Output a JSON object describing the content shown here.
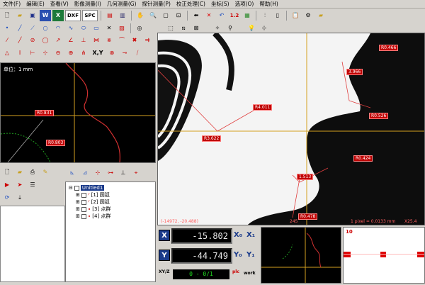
{
  "menu": [
    "文件(F)",
    "编辑(E)",
    "查看(V)",
    "影像测量(I)",
    "几何测量(G)",
    "探针测量(P)",
    "校正处理(C)",
    "坐标(S)",
    "选项(O)",
    "帮助(H)"
  ],
  "toolbar1": {
    "dxf_label": "DXF",
    "spc_label": "SPC",
    "count_label": "1.2"
  },
  "toolbar3": {
    "xy_label": "X,Y"
  },
  "left_view": {
    "unit_label": "单位：1 mm",
    "measure_a": "R0.831",
    "measure_b": "R0.803"
  },
  "main_view": {
    "labels": {
      "r1": "R0.466",
      "r2": "3.966",
      "r3": "R0.526",
      "r4": "R0.424",
      "r5": "1.513",
      "r6": "R0.478",
      "r7": "R4.011",
      "r8": "R3.622"
    },
    "status_left": "(-14972, -20.488)",
    "status_mid": "245",
    "status_right": "1 pixel = 0.0133 mm",
    "zoom": "X25.4"
  },
  "tree": {
    "root": "Unitled1",
    "items": [
      "[1] 圆弧",
      "[2] 圆弧",
      "[3] 点群",
      "[4] 点群"
    ]
  },
  "coords": {
    "x_axis": "X",
    "y_axis": "Y",
    "x_value": "-15.802",
    "y_value": "-44.749",
    "x_unit": "X₀",
    "y_unit": "Y₀",
    "x_extra": "X₁",
    "y_extra": "Y₁",
    "counter": "0 - 0/1",
    "small_label_a": "plc",
    "small_label_b": "work",
    "xyz_label": "XY/Z"
  },
  "zoom_panel": {
    "value": "10"
  },
  "colors": {
    "accent_red": "#c00000",
    "axis_blue": "#1a3a8a",
    "crosshair": "#d4a020"
  }
}
